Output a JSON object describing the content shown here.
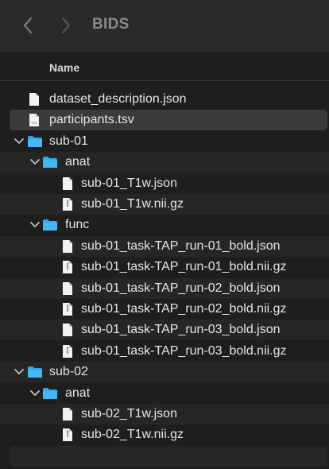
{
  "window": {
    "title": "BIDS"
  },
  "toolbar": {
    "back_icon": "chevron-left-icon",
    "forward_icon": "chevron-right-icon"
  },
  "header": {
    "name_column": "Name"
  },
  "colors": {
    "folder": "#2ea8f0",
    "file": "#f2f2f2",
    "selected_row": "#3b3b3b"
  },
  "files": [
    {
      "name": "dataset_description.json",
      "kind": "file",
      "depth": 0
    },
    {
      "name": "participants.tsv",
      "kind": "file-tsv",
      "depth": 0,
      "selected": true
    },
    {
      "name": "sub-01",
      "kind": "folder",
      "depth": 0,
      "expanded": true
    },
    {
      "name": "anat",
      "kind": "folder",
      "depth": 1,
      "expanded": true
    },
    {
      "name": "sub-01_T1w.json",
      "kind": "file",
      "depth": 2
    },
    {
      "name": "sub-01_T1w.nii.gz",
      "kind": "file-gz",
      "depth": 2
    },
    {
      "name": "func",
      "kind": "folder",
      "depth": 1,
      "expanded": true
    },
    {
      "name": "sub-01_task-TAP_run-01_bold.json",
      "kind": "file",
      "depth": 2
    },
    {
      "name": "sub-01_task-TAP_run-01_bold.nii.gz",
      "kind": "file-gz",
      "depth": 2
    },
    {
      "name": "sub-01_task-TAP_run-02_bold.json",
      "kind": "file",
      "depth": 2
    },
    {
      "name": "sub-01_task-TAP_run-02_bold.nii.gz",
      "kind": "file-gz",
      "depth": 2
    },
    {
      "name": "sub-01_task-TAP_run-03_bold.json",
      "kind": "file",
      "depth": 2
    },
    {
      "name": "sub-01_task-TAP_run-03_bold.nii.gz",
      "kind": "file-gz",
      "depth": 2
    },
    {
      "name": "sub-02",
      "kind": "folder",
      "depth": 0,
      "expanded": true
    },
    {
      "name": "anat",
      "kind": "folder",
      "depth": 1,
      "expanded": true
    },
    {
      "name": "sub-02_T1w.json",
      "kind": "file",
      "depth": 2
    },
    {
      "name": "sub-02_T1w.nii.gz",
      "kind": "file-gz",
      "depth": 2
    }
  ]
}
